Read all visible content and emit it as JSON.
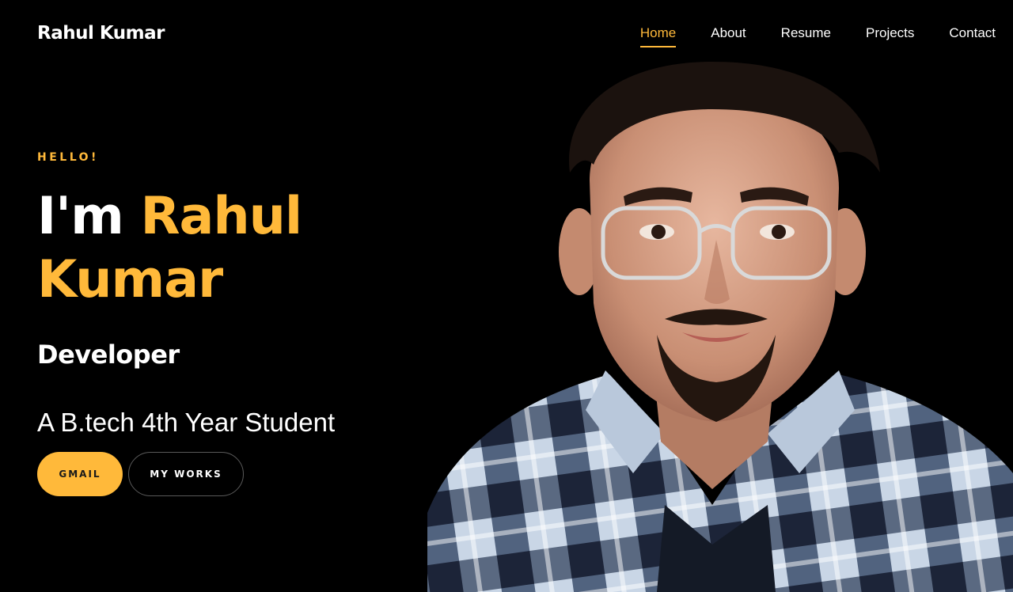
{
  "header": {
    "brand": "Rahul Kumar",
    "nav": [
      {
        "label": "Home",
        "active": true
      },
      {
        "label": "About",
        "active": false
      },
      {
        "label": "Resume",
        "active": false
      },
      {
        "label": "Projects",
        "active": false
      },
      {
        "label": "Contact",
        "active": false
      }
    ]
  },
  "hero": {
    "greeting": "HELLO!",
    "title_prefix": "I'm ",
    "title_first": "Rahul",
    "title_last": "Kumar",
    "role": "Developer",
    "tagline": "A B.tech 4th Year Student",
    "primary_button": "GMAIL",
    "secondary_button": "MY WORKS",
    "portrait_icon": "person-portrait"
  },
  "colors": {
    "background": "#000000",
    "accent": "#ffb93a",
    "text": "#ffffff"
  }
}
